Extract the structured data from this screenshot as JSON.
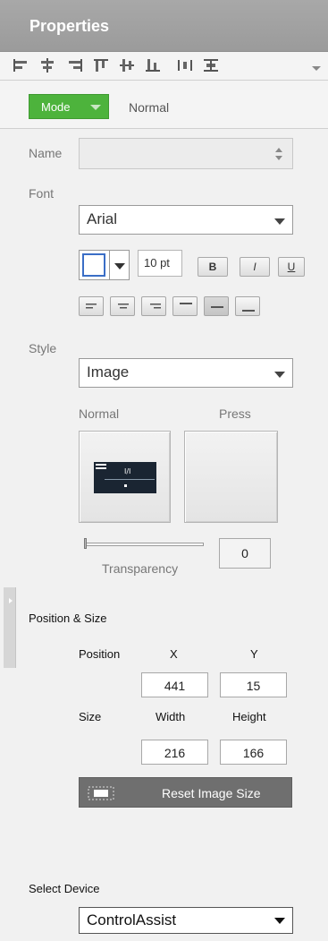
{
  "panel": {
    "title": "Properties"
  },
  "toolbar": {
    "icons": [
      "align-left-icon",
      "align-center-icon",
      "align-right-icon",
      "align-top-icon",
      "align-middle-icon",
      "align-bottom-icon",
      "distribute-horizontal-icon",
      "distribute-vertical-icon",
      "more-dropdown-icon"
    ]
  },
  "mode": {
    "label": "Mode",
    "value": "Normal",
    "color": "#4db33c"
  },
  "name": {
    "label": "Name",
    "value": ""
  },
  "font": {
    "label": "Font",
    "family": "Arial",
    "size": "10 pt",
    "bold": "B",
    "italic": "I",
    "underline": "U"
  },
  "style": {
    "label": "Style",
    "value": "Image",
    "normal_label": "Normal",
    "press_label": "Press",
    "transparency_label": "Transparency",
    "transparency_value": "0"
  },
  "position_size": {
    "heading": "Position & Size",
    "position_label": "Position",
    "x_label": "X",
    "y_label": "Y",
    "x": "441",
    "y": "15",
    "size_label": "Size",
    "width_label": "Width",
    "height_label": "Height",
    "width": "216",
    "height": "166",
    "reset_label": "Reset Image Size"
  },
  "device": {
    "label": "Select Device",
    "value": "ControlAssist"
  }
}
